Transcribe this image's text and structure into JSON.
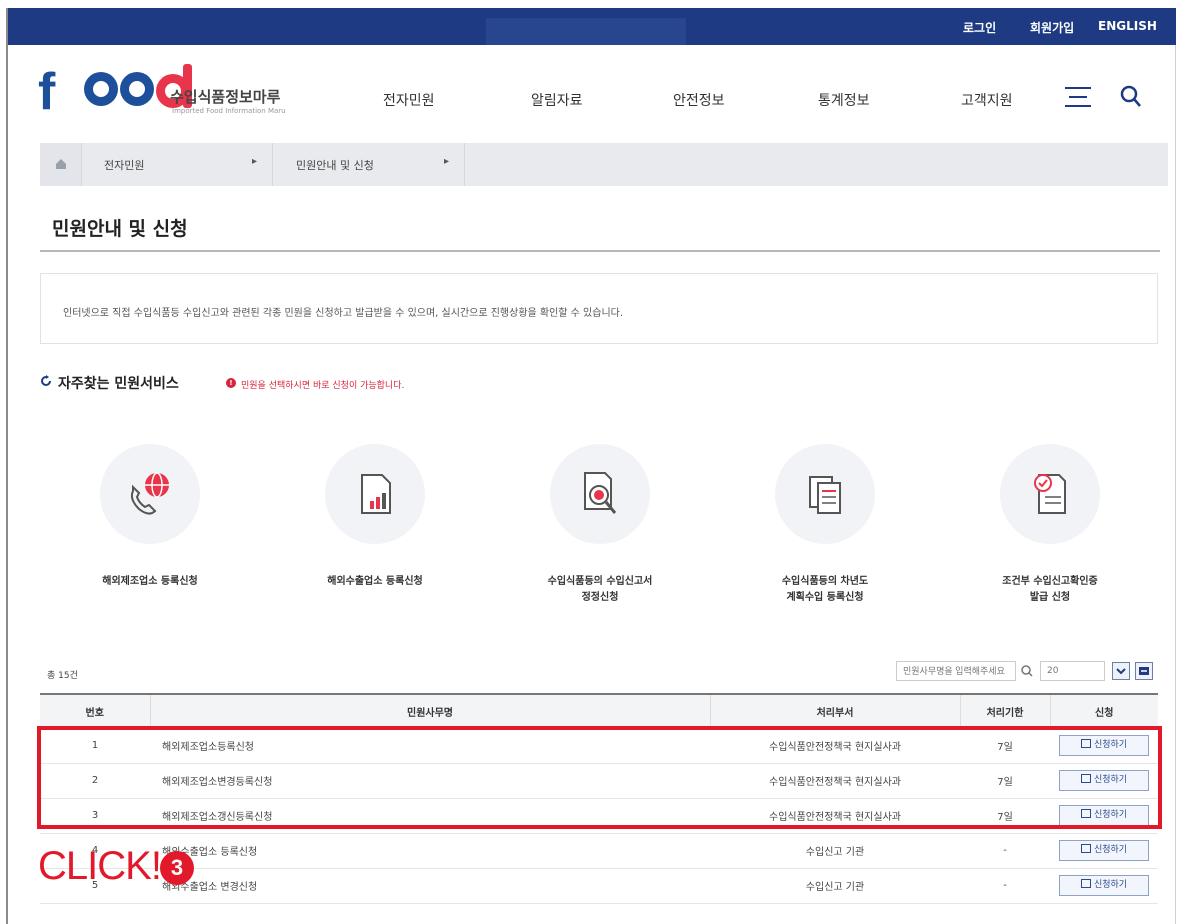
{
  "topbar": {
    "login": "로그인",
    "join": "회원가입",
    "english": "ENGLISH"
  },
  "brand": {
    "logo_text": "food",
    "name_ko": "수입식품정보마루",
    "name_en": "Imported Food Information Maru"
  },
  "gnb": [
    "전자민원",
    "알림자료",
    "안전정보",
    "통계정보",
    "고객지원"
  ],
  "icons": {
    "menu": "hamburger-icon",
    "search": "search-icon",
    "home": "home-icon"
  },
  "breadcrumb": {
    "level1": "전자민원",
    "level2": "민원안내 및 신청",
    "arrow": "▸"
  },
  "page": {
    "title": "민원안내 및 신청",
    "intro": "인터넷으로 직접 수입식품등 수입신고와 관련된 각종 민원을 신청하고 발급받을 수 있으며, 실시간으로 진행상황을 확인할 수 있습니다."
  },
  "services": {
    "title": "자주찾는 민원서비스",
    "note_badge": "!",
    "note": "민원을 선택하시면 바로 신청이 가능합니다.",
    "items": [
      {
        "line1": "해외제조업소 등록신청",
        "line2": ""
      },
      {
        "line1": "해외수출업소 등록신청",
        "line2": ""
      },
      {
        "line1": "수입식품등의 수입신고서",
        "line2": "정정신청"
      },
      {
        "line1": "수입식품등의 차년도",
        "line2": "계획수입 등록신청"
      },
      {
        "line1": "조건부 수입신고확인증",
        "line2": "발급 신청"
      }
    ]
  },
  "list": {
    "count": "총 15건",
    "search_placeholder": "민원사무명을 입력해주세요",
    "page_size": "20",
    "headers": [
      "번호",
      "민원사무명",
      "처리부서",
      "처리기한",
      "신청"
    ],
    "apply_label": "신청하기",
    "rows": [
      {
        "no": "1",
        "name": "해외제조업소등록신청",
        "dept": "수입식품안전정책국 현지실사과",
        "period": "7일"
      },
      {
        "no": "2",
        "name": "해외제조업소변경등록신청",
        "dept": "수입식품안전정책국 현지실사과",
        "period": "7일"
      },
      {
        "no": "3",
        "name": "해외제조업소갱신등록신청",
        "dept": "수입식품안전정책국 현지실사과",
        "period": "7일"
      },
      {
        "no": "4",
        "name": "해외수출업소 등록신청",
        "dept": "수입신고 기관",
        "period": "-"
      },
      {
        "no": "5",
        "name": "해외수출업소 변경신청",
        "dept": "수입신고 기관",
        "period": "-"
      }
    ]
  },
  "annotation": {
    "label": "CLICK!",
    "step": "3",
    "color": "#e1192b"
  },
  "colors": {
    "topbar": "#1d3a82",
    "brand_blue": "#1d4f9a",
    "brand_red": "#e8354b",
    "accent_red": "#d9253b"
  }
}
